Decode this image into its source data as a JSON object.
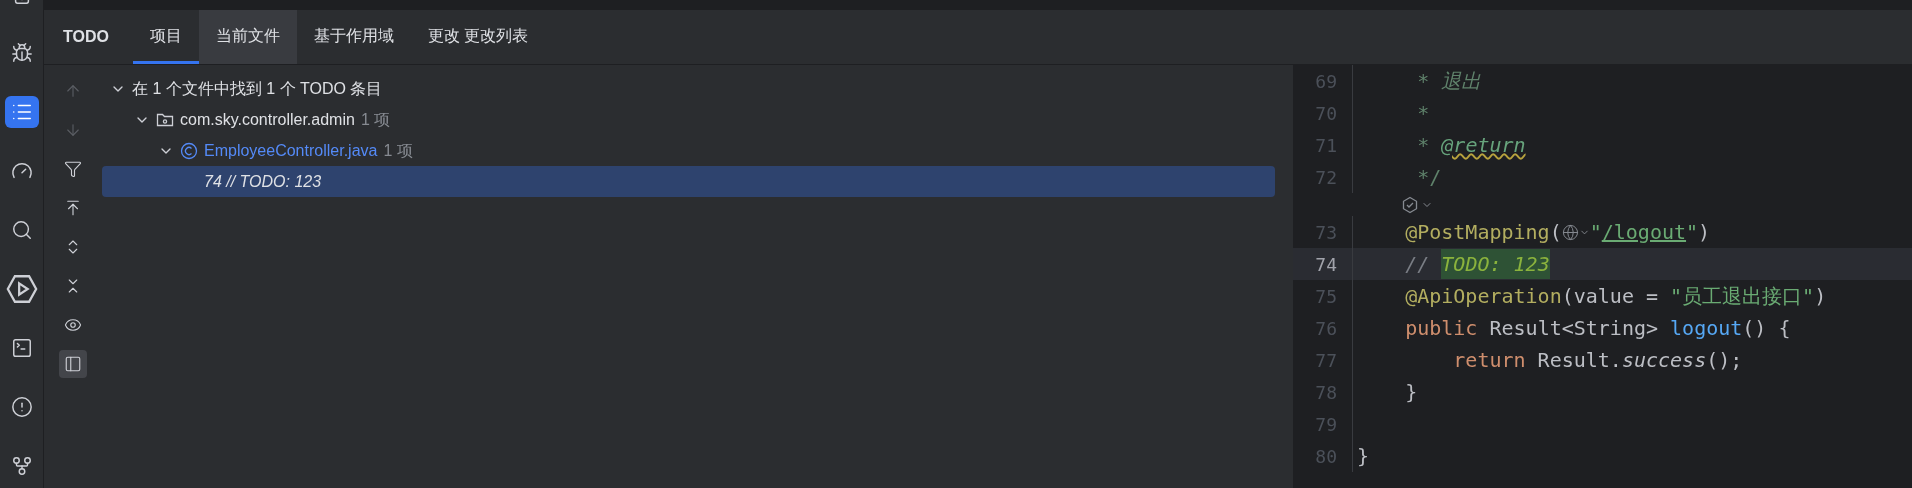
{
  "activity_bar": [
    {
      "kind": "device",
      "selected": false
    },
    {
      "kind": "bug",
      "selected": false
    },
    {
      "kind": "list",
      "selected": true
    },
    {
      "kind": "gauge",
      "selected": false
    },
    {
      "kind": "search",
      "selected": false
    },
    {
      "kind": "run",
      "selected": false
    },
    {
      "kind": "terminal",
      "selected": false
    },
    {
      "kind": "problems",
      "selected": false
    },
    {
      "kind": "git",
      "selected": false
    }
  ],
  "panel": {
    "title": "TODO",
    "tabs": [
      {
        "label": "项目",
        "selected": true,
        "hovered": false
      },
      {
        "label": "当前文件",
        "selected": false,
        "hovered": true
      },
      {
        "label": "基于作用域",
        "selected": false,
        "hovered": false
      },
      {
        "label": "更改 更改列表",
        "selected": false,
        "hovered": false
      }
    ],
    "toolbar": [
      {
        "kind": "up",
        "disabled": true,
        "selected": false
      },
      {
        "kind": "down",
        "disabled": true,
        "selected": false
      },
      {
        "kind": "filter",
        "disabled": false,
        "selected": false
      },
      {
        "kind": "export",
        "disabled": false,
        "selected": false
      },
      {
        "kind": "expand",
        "disabled": false,
        "selected": false
      },
      {
        "kind": "collapse",
        "disabled": false,
        "selected": false
      },
      {
        "kind": "preview",
        "disabled": false,
        "selected": false
      },
      {
        "kind": "layout",
        "disabled": false,
        "selected": true
      }
    ],
    "tree": [
      {
        "kind": "summary",
        "label": "在 1 个文件中找到 1 个 TODO 条目",
        "expanded": true,
        "selected": false,
        "children": [
          {
            "kind": "package",
            "label": "com.sky.controller.admin",
            "count": "1 项",
            "expanded": true,
            "selected": false,
            "children": [
              {
                "kind": "class",
                "label": "EmployeeController.java",
                "count": "1 项",
                "expanded": true,
                "selected": false,
                "children": [
                  {
                    "kind": "todo",
                    "label": "74 // TODO: 123",
                    "selected": true
                  }
                ]
              }
            ]
          }
        ]
      }
    ]
  },
  "editor": {
    "lines": [
      {
        "kind": "code",
        "number": "69",
        "current": false,
        "tokens": [
          {
            "kind": "doc",
            "text": "     * "
          },
          {
            "kind": "doc-italic",
            "text": "退出"
          }
        ]
      },
      {
        "kind": "code",
        "number": "70",
        "current": false,
        "tokens": [
          {
            "kind": "doc",
            "text": "     *"
          }
        ]
      },
      {
        "kind": "code",
        "number": "71",
        "current": false,
        "tokens": [
          {
            "kind": "doc",
            "text": "     * "
          },
          {
            "kind": "doc-tag",
            "text": "@return"
          }
        ]
      },
      {
        "kind": "code",
        "number": "72",
        "current": false,
        "tokens": [
          {
            "kind": "doc",
            "text": "     */"
          }
        ]
      },
      {
        "kind": "hint"
      },
      {
        "kind": "code",
        "number": "73",
        "current": false,
        "tokens": [
          {
            "kind": "annotation",
            "text": "    @PostMapping"
          },
          {
            "kind": "plain",
            "text": "("
          },
          {
            "kind": "globe"
          },
          {
            "kind": "string",
            "text": "\""
          },
          {
            "kind": "link",
            "text": "/logout"
          },
          {
            "kind": "string",
            "text": "\""
          },
          {
            "kind": "plain",
            "text": ")"
          }
        ]
      },
      {
        "kind": "code",
        "number": "74",
        "current": true,
        "tokens": [
          {
            "kind": "comment",
            "text": "    // "
          },
          {
            "kind": "todo",
            "text": "TODO: 123"
          }
        ]
      },
      {
        "kind": "code",
        "number": "75",
        "current": false,
        "tokens": [
          {
            "kind": "annotation",
            "text": "    @ApiOperation"
          },
          {
            "kind": "plain",
            "text": "(value = "
          },
          {
            "kind": "string",
            "text": "\"员工退出接口\""
          },
          {
            "kind": "plain",
            "text": ")"
          }
        ]
      },
      {
        "kind": "code",
        "number": "76",
        "current": false,
        "tokens": [
          {
            "kind": "keyword",
            "text": "    public"
          },
          {
            "kind": "plain",
            "text": " Result<String> "
          },
          {
            "kind": "method",
            "text": "logout"
          },
          {
            "kind": "plain",
            "text": "() {"
          }
        ]
      },
      {
        "kind": "code",
        "number": "77",
        "current": false,
        "tokens": [
          {
            "kind": "keyword",
            "text": "        return"
          },
          {
            "kind": "plain",
            "text": " Result."
          },
          {
            "kind": "static",
            "text": "success"
          },
          {
            "kind": "plain",
            "text": "();"
          }
        ]
      },
      {
        "kind": "code",
        "number": "78",
        "current": false,
        "tokens": [
          {
            "kind": "plain",
            "text": "    }"
          }
        ]
      },
      {
        "kind": "code",
        "number": "79",
        "current": false
      },
      {
        "kind": "code",
        "number": "80",
        "current": false,
        "tokens": [
          {
            "kind": "plain",
            "text": "}"
          }
        ]
      }
    ]
  }
}
